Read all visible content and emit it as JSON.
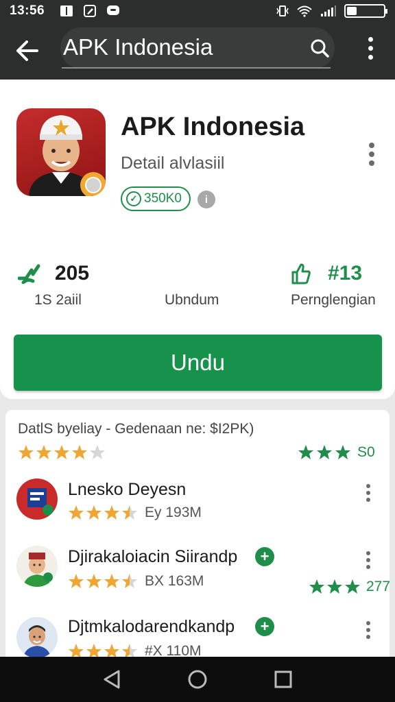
{
  "status_bar": {
    "time": "13:56",
    "left_icons": [
      "book-icon",
      "edit-icon",
      "chat-icon"
    ],
    "right_icons": [
      "vibrate-icon",
      "wifi-icon",
      "signal-icon",
      "battery-icon"
    ]
  },
  "toolbar": {
    "title": "APK Indonesia",
    "back_icon": "arrow-left-icon",
    "search_icon": "search-icon",
    "menu_icon": "more-vert-icon"
  },
  "app": {
    "name": "APK Indonesia",
    "subtitle": "Detail alvlasiil",
    "badge": "350K0",
    "stats": {
      "rating_value": "205",
      "rating_label": "1S 2aiil",
      "download_label": "Ubndum",
      "install_value": "#13",
      "install_label": "Pernglengian"
    },
    "install_button": "Undu"
  },
  "reviews": {
    "header": "DatlS byeliay - Gedenaan ne: $I2PK)",
    "overall_left_stars": 4,
    "overall_right_score": "S0",
    "items": [
      {
        "name": "Lnesko Deyesn",
        "stars": 3.5,
        "size": "Ey 193M",
        "verified": false,
        "right_score": ""
      },
      {
        "name": "Djirakaloiacin Siirandp",
        "stars": 3.5,
        "size": "BX 163M",
        "verified": true,
        "right_score": "277"
      },
      {
        "name": "Djtmkalodarendkandp",
        "stars": 3.5,
        "size": "#X 110M",
        "verified": true,
        "right_score": ""
      }
    ]
  },
  "nav_bar": {
    "icons": [
      "back-triangle-icon",
      "home-circle-icon",
      "recents-square-icon"
    ]
  },
  "colors": {
    "accent_green": "#17924c",
    "star_gold": "#f1a532",
    "toolbar_dark": "#2c2e2d"
  }
}
